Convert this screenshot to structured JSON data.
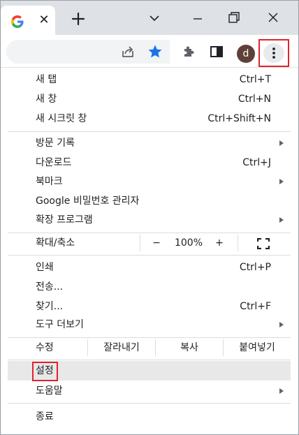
{
  "tab": {
    "close_symbol": "✕"
  },
  "window": {
    "avatar_letter": "d"
  },
  "menu": {
    "new_tab": {
      "label": "새 탭",
      "shortcut": "Ctrl+T"
    },
    "new_window": {
      "label": "새 창",
      "shortcut": "Ctrl+N"
    },
    "new_incognito": {
      "label": "새 시크릿 창",
      "shortcut": "Ctrl+Shift+N"
    },
    "history": {
      "label": "방문 기록"
    },
    "downloads": {
      "label": "다운로드",
      "shortcut": "Ctrl+J"
    },
    "bookmarks": {
      "label": "북마크"
    },
    "password_manager": {
      "label": "Google 비밀번호 관리자"
    },
    "extensions": {
      "label": "확장 프로그램"
    },
    "zoom": {
      "label": "확대/축소",
      "minus": "−",
      "value": "100%",
      "plus": "+"
    },
    "print": {
      "label": "인쇄",
      "shortcut": "Ctrl+P"
    },
    "cast": {
      "label": "전송..."
    },
    "find": {
      "label": "찾기...",
      "shortcut": "Ctrl+F"
    },
    "more_tools": {
      "label": "도구 더보기"
    },
    "edit": {
      "label": "수정",
      "cut": "잘라내기",
      "copy": "복사",
      "paste": "붙여넣기"
    },
    "settings": {
      "label": "설정"
    },
    "help": {
      "label": "도움말"
    },
    "exit": {
      "label": "종료"
    }
  },
  "colors": {
    "accent": "#1a73e8",
    "highlight_box": "#e0232c",
    "avatar_bg": "#5d4037"
  }
}
